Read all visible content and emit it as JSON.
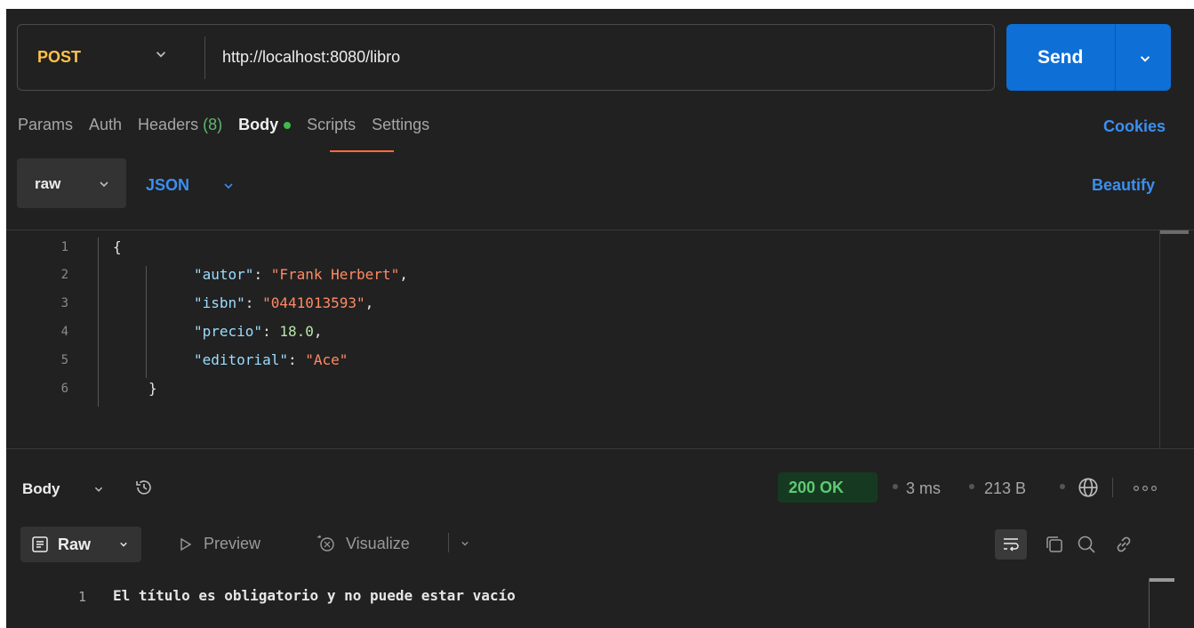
{
  "request": {
    "method": "POST",
    "url": "http://localhost:8080/libro",
    "send_label": "Send"
  },
  "tabs": [
    {
      "label": "Params"
    },
    {
      "label": "Auth"
    },
    {
      "label": "Headers",
      "count": "(8)"
    },
    {
      "label": "Body"
    },
    {
      "label": "Scripts"
    },
    {
      "label": "Settings"
    }
  ],
  "cookies_label": "Cookies",
  "body_options": {
    "mode": "raw",
    "language": "JSON",
    "beautify_label": "Beautify"
  },
  "editor": {
    "lines": [
      {
        "n": "1",
        "text": "{"
      },
      {
        "n": "2",
        "key": "\"autor\"",
        "value": "\"Frank Herbert\"",
        "tail": ","
      },
      {
        "n": "3",
        "key": "\"isbn\"",
        "value": "\"0441013593\"",
        "tail": ","
      },
      {
        "n": "4",
        "key": "\"precio\"",
        "value": "18.0",
        "tail": ","
      },
      {
        "n": "5",
        "key": "\"editorial\"",
        "value": "\"Ace\"",
        "tail": ""
      },
      {
        "n": "6",
        "text": "}"
      }
    ]
  },
  "response": {
    "section_label": "Body",
    "status": "200 OK",
    "time": "3 ms",
    "size": "213 B",
    "view_mode": "Raw",
    "preview_label": "Preview",
    "visualize_label": "Visualize",
    "lines": [
      {
        "n": "1",
        "text": "El título es obligatorio y no puede estar vacío"
      }
    ]
  },
  "colors": {
    "accent": "#ff6c37",
    "method": "#ffc24b",
    "link": "#3b8ff0",
    "send": "#0e6fd6",
    "status_ok": "#5ccc73"
  }
}
